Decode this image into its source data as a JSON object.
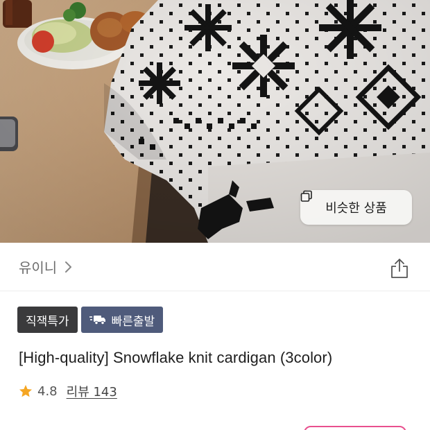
{
  "photo": {
    "alt": "Snowflake knit cardigan product photo",
    "similar_products_label": "비슷한 상품"
  },
  "store": {
    "name": "유이니"
  },
  "badges": [
    {
      "label": "직잭특가"
    },
    {
      "label": "빠른출발"
    }
  ],
  "product": {
    "title": "[High-quality] Snowflake knit cardigan (3color)",
    "rating": "4.8",
    "review_label": "리뷰 143"
  },
  "colors": {
    "badge_dark": "#3a3a3c",
    "badge_blue": "#4f5b7b",
    "star": "#f5a623",
    "accent_pink": "#e8508e"
  }
}
